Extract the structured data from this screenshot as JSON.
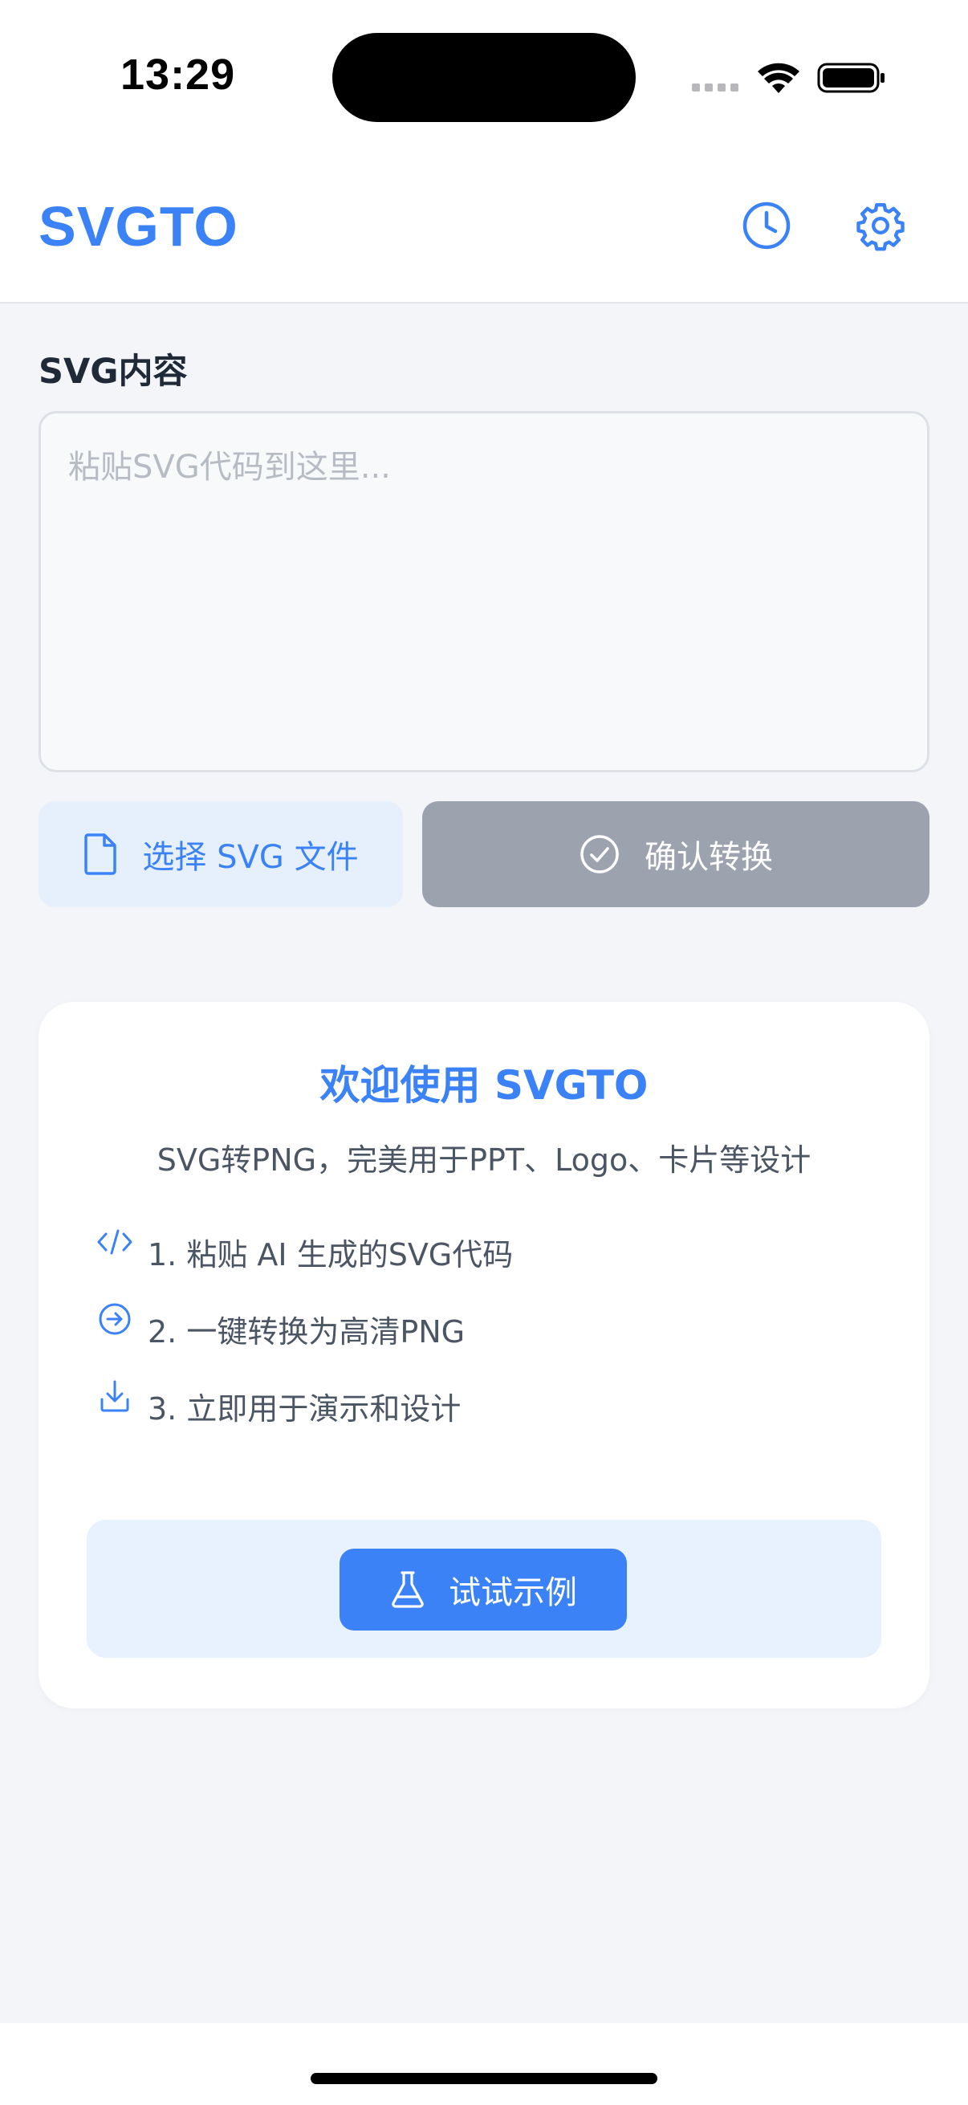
{
  "status_bar": {
    "time": "13:29"
  },
  "header": {
    "title": "SVGTO",
    "history_icon": "clock-icon",
    "settings_icon": "gear-icon"
  },
  "editor": {
    "label": "SVG内容",
    "placeholder": "粘贴SVG代码到这里...",
    "value": ""
  },
  "actions": {
    "choose_file_label": "选择 SVG 文件",
    "choose_file_icon": "file-icon",
    "confirm_label": "确认转换",
    "confirm_icon": "check-circle-icon"
  },
  "welcome": {
    "title": "欢迎使用 SVGTO",
    "subtitle": "SVG转PNG，完美用于PPT、Logo、卡片等设计",
    "steps": [
      {
        "icon": "code-icon",
        "text": "1. 粘贴 AI 生成的SVG代码"
      },
      {
        "icon": "arrow-right-circle-icon",
        "text": "2. 一键转换为高清PNG"
      },
      {
        "icon": "download-icon",
        "text": "3. 立即用于演示和设计"
      }
    ],
    "try_label": "试试示例",
    "try_icon": "flask-icon"
  },
  "colors": {
    "accent": "#3b82f6",
    "disabled": "#9ca3af",
    "accent_light": "#e6f0fd",
    "background": "#f3f5f9"
  }
}
